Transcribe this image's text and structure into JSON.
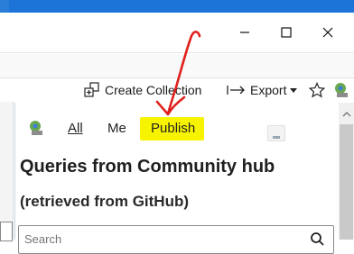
{
  "window": {
    "minimize_icon": "minimize-icon",
    "maximize_icon": "maximize-icon",
    "close_icon": "close-icon"
  },
  "toolbar": {
    "create_collection_label": "Create Collection",
    "export_label": "Export",
    "export_icon": "arrow-right-bar-icon",
    "export_dropdown_icon": "caret-down-icon",
    "star_icon": "star-icon",
    "extension_icon": "extension-icon"
  },
  "panel": {
    "tabs": [
      {
        "label": "All"
      },
      {
        "label": "Me"
      },
      {
        "label": "Publish"
      }
    ],
    "highlight_color": "#f8f400",
    "heading": "Queries from Community hub",
    "subheading": "(retrieved from GitHub)",
    "search_placeholder": "Search",
    "annotation_color": "#e0201b"
  }
}
